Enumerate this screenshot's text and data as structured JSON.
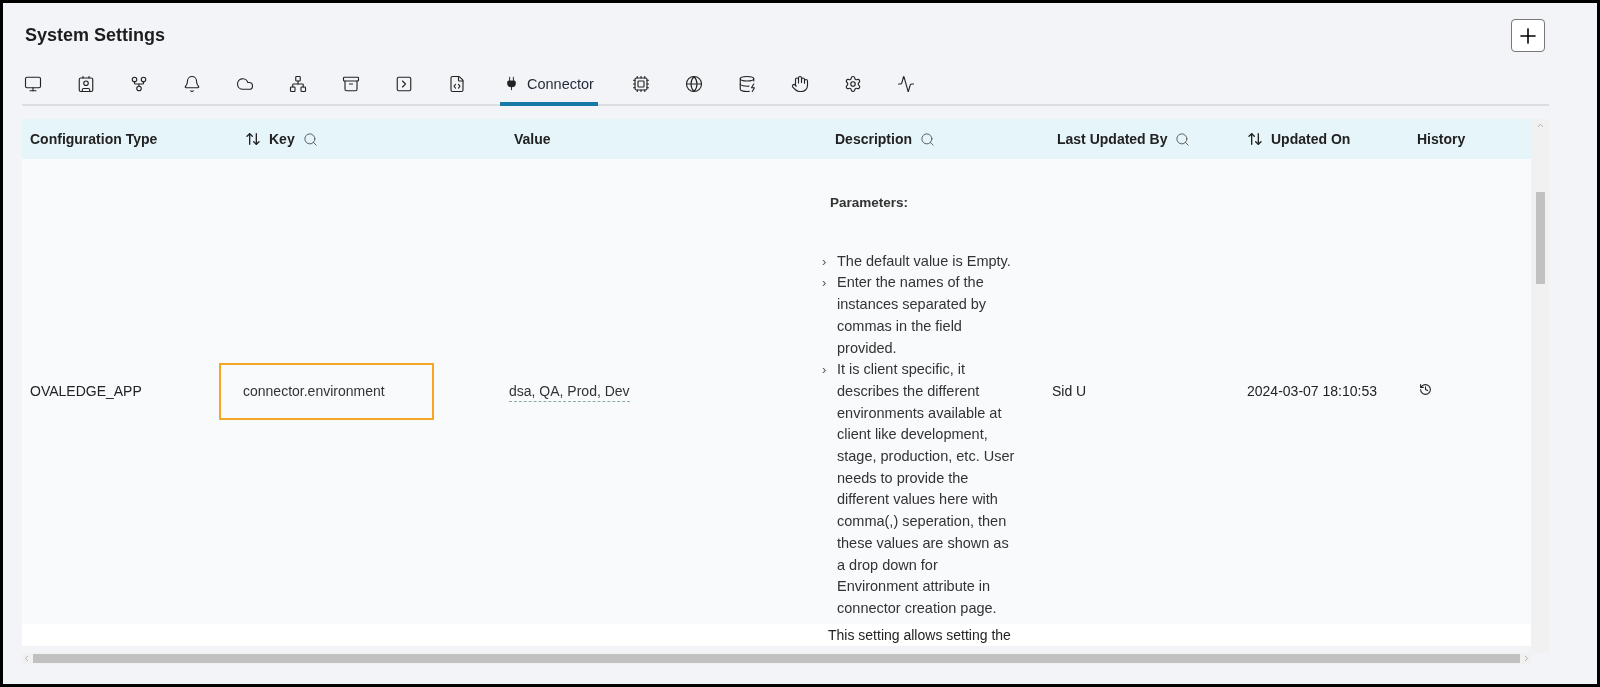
{
  "page": {
    "title": "System Settings"
  },
  "tabs": [
    {
      "kind": "icon",
      "selected": false
    },
    {
      "kind": "icon",
      "selected": false
    },
    {
      "kind": "icon",
      "selected": false
    },
    {
      "kind": "icon",
      "selected": false
    },
    {
      "kind": "icon",
      "selected": false
    },
    {
      "kind": "icon",
      "selected": false
    },
    {
      "kind": "icon",
      "selected": false
    },
    {
      "kind": "icon",
      "selected": false
    },
    {
      "kind": "icon",
      "selected": false
    },
    {
      "kind": "labeled",
      "label": "Connector",
      "selected": true
    },
    {
      "kind": "icon",
      "selected": false
    },
    {
      "kind": "icon",
      "selected": false
    },
    {
      "kind": "icon",
      "selected": false
    },
    {
      "kind": "icon",
      "selected": false
    },
    {
      "kind": "icon",
      "selected": false
    },
    {
      "kind": "icon",
      "selected": false
    }
  ],
  "table": {
    "columns": [
      {
        "label": "Configuration Type",
        "sortable": false,
        "searchable": false
      },
      {
        "label": "Key",
        "sortable": true,
        "searchable": true
      },
      {
        "label": "Value",
        "sortable": false,
        "searchable": false
      },
      {
        "label": "Description",
        "sortable": false,
        "searchable": true
      },
      {
        "label": "Last Updated By",
        "sortable": false,
        "searchable": true
      },
      {
        "label": "Updated On",
        "sortable": true,
        "searchable": false
      },
      {
        "label": "History",
        "sortable": false,
        "searchable": false
      }
    ],
    "rows": [
      {
        "configuration_type": "OVALEDGE_APP",
        "key": "connector.environment",
        "highlighted": true,
        "value": "dsa, QA, Prod, Dev",
        "description": {
          "heading": "Parameters:",
          "items": [
            {
              "marker": "›",
              "text": "The default value is Empty."
            },
            {
              "marker": "›",
              "text": "Enter the names of the instances separated by commas in the field provided."
            },
            {
              "marker": "›",
              "text": "It is client specific, it describes the different environments available at client like development, stage, production, etc. User needs to provide the different values here with comma(,) seperation, then these values are shown as a drop down for Environment attribute in connector creation page."
            }
          ]
        },
        "last_updated_by": "Sid U",
        "updated_on": "2024-03-07 18:10:53"
      },
      {
        "description": {
          "text": "This setting allows setting the"
        }
      }
    ]
  }
}
